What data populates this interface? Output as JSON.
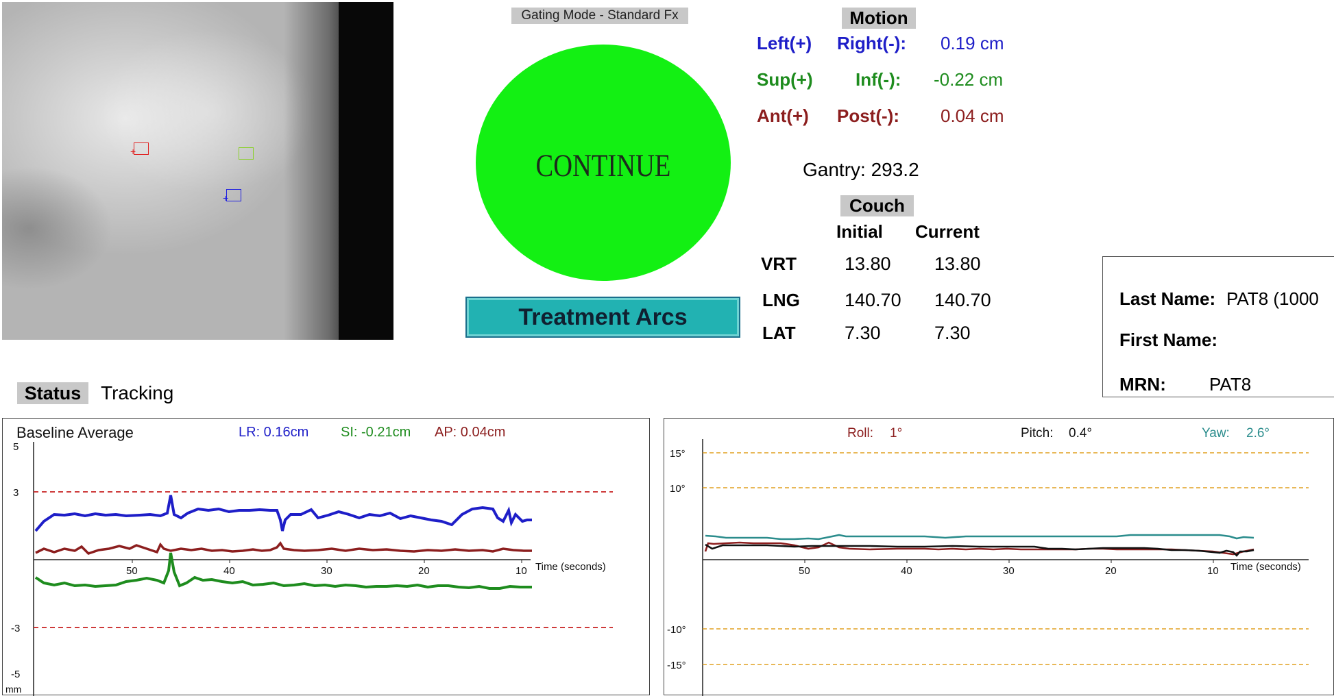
{
  "gating": {
    "mode_label": "Gating Mode - Standard Fx",
    "indicator_text": "CONTINUE",
    "indicator_color": "#13f013",
    "treatment_button": "Treatment Arcs"
  },
  "motion": {
    "title": "Motion",
    "rows": [
      {
        "pos_label": "Left(+)",
        "neg_label": "Right(-):",
        "value": "0.19 cm",
        "color": "#1e1ec8"
      },
      {
        "pos_label": "Sup(+)",
        "neg_label": "Inf(-):",
        "value": "-0.22 cm",
        "color": "#1e8c1e"
      },
      {
        "pos_label": "Ant(+)",
        "neg_label": "Post(-):",
        "value": "0.04 cm",
        "color": "#8c1e1e"
      }
    ],
    "gantry": "Gantry: 293.2"
  },
  "couch": {
    "title": "Couch",
    "col_initial": "Initial",
    "col_current": "Current",
    "rows": [
      {
        "label": "VRT",
        "initial": "13.80",
        "current": "13.80"
      },
      {
        "label": "LNG",
        "initial": "140.70",
        "current": "140.70"
      },
      {
        "label": "LAT",
        "initial": "7.30",
        "current": "7.30"
      }
    ]
  },
  "patient": {
    "last_name_label": "Last Name:",
    "last_name_value": "PAT8 (1000",
    "first_name_label": "First Name:",
    "first_name_value": "",
    "mrn_label": "MRN:",
    "mrn_value": "PAT8"
  },
  "status": {
    "label": "Status",
    "value": "Tracking"
  },
  "translation_panel": {
    "title": "Baseline Average",
    "lr": "LR: 0.16cm",
    "si": "SI: -0.21cm",
    "ap": "AP: 0.04cm",
    "y_unit": "mm",
    "x_axis_label": "Time (seconds)"
  },
  "rotation_panel": {
    "roll_label": "Roll:",
    "roll_value": "1°",
    "pitch_label": "Pitch:",
    "pitch_value": "0.4°",
    "yaw_label": "Yaw:",
    "yaw_value": "2.6°",
    "x_axis_label": "Time (seconds)"
  },
  "chart_data": [
    {
      "type": "line",
      "x_label": "Time (seconds)",
      "y_unit": "mm",
      "x_ticks": [
        50,
        40,
        30,
        20,
        10
      ],
      "y_ticks_upper": [
        5,
        3
      ],
      "y_ticks_lower": [
        -3,
        -5
      ],
      "threshold_lines": [
        3,
        -3
      ],
      "series": [
        {
          "name": "LR",
          "color": "#1e1ec8"
        },
        {
          "name": "AP",
          "color": "#8c1e1e"
        },
        {
          "name": "SI",
          "color": "#1e8c1e"
        }
      ]
    },
    {
      "type": "line",
      "x_label": "Time (seconds)",
      "x_ticks": [
        50,
        40,
        30,
        20,
        10
      ],
      "y_ticks": [
        "15°",
        "10°",
        "-10°",
        "-15°"
      ],
      "threshold_lines": [
        15,
        10,
        -10,
        -15
      ],
      "series": [
        {
          "name": "Roll",
          "color": "#8c1e1e"
        },
        {
          "name": "Pitch",
          "color": "#111111"
        },
        {
          "name": "Yaw",
          "color": "#2a8c8c"
        }
      ]
    }
  ]
}
